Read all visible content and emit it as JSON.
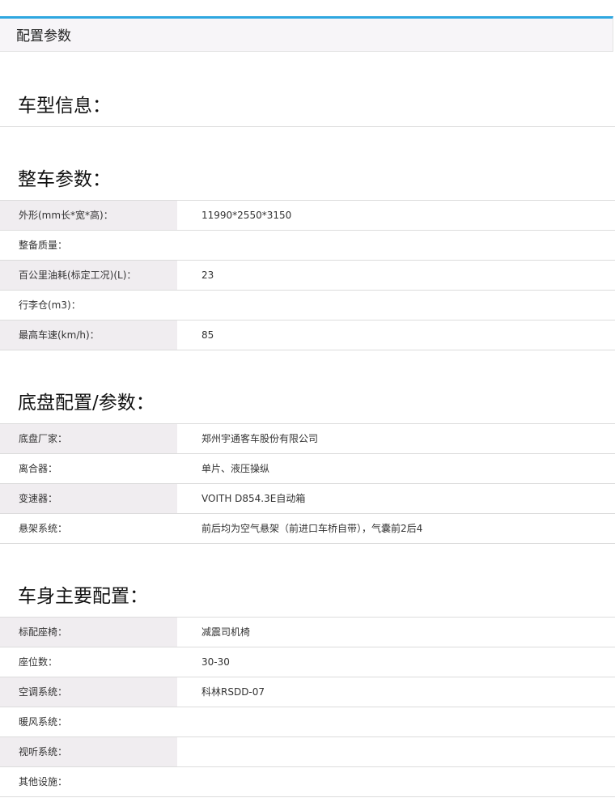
{
  "panel": {
    "title": "配置参数"
  },
  "sections": {
    "model": {
      "title": "车型信息："
    },
    "vehicle": {
      "title": "整车参数：",
      "rows": [
        {
          "label": "外形(mm长*宽*高)：",
          "value": "11990*2550*3150"
        },
        {
          "label": "整备质量：",
          "value": ""
        },
        {
          "label": "百公里油耗(标定工况)(L)：",
          "value": "23"
        },
        {
          "label": "行李仓(m3)：",
          "value": ""
        },
        {
          "label": "最高车速(km/h)：",
          "value": "85"
        }
      ]
    },
    "chassis": {
      "title": "底盘配置/参数：",
      "rows": [
        {
          "label": "底盘厂家：",
          "value": "郑州宇通客车股份有限公司"
        },
        {
          "label": "离合器：",
          "value": "单片、液压操纵"
        },
        {
          "label": "变速器：",
          "value": "VOITH D854.3E自动箱"
        },
        {
          "label": "悬架系统：",
          "value": "前后均为空气悬架（前进口车桥自带），气囊前2后4"
        }
      ]
    },
    "body": {
      "title": "车身主要配置：",
      "rows": [
        {
          "label": "标配座椅：",
          "value": "减震司机椅"
        },
        {
          "label": "座位数：",
          "value": "30-30"
        },
        {
          "label": "空调系统：",
          "value": "科林RSDD-07"
        },
        {
          "label": "暖风系统：",
          "value": ""
        },
        {
          "label": "视听系统：",
          "value": ""
        },
        {
          "label": "其他设施：",
          "value": ""
        }
      ]
    }
  }
}
